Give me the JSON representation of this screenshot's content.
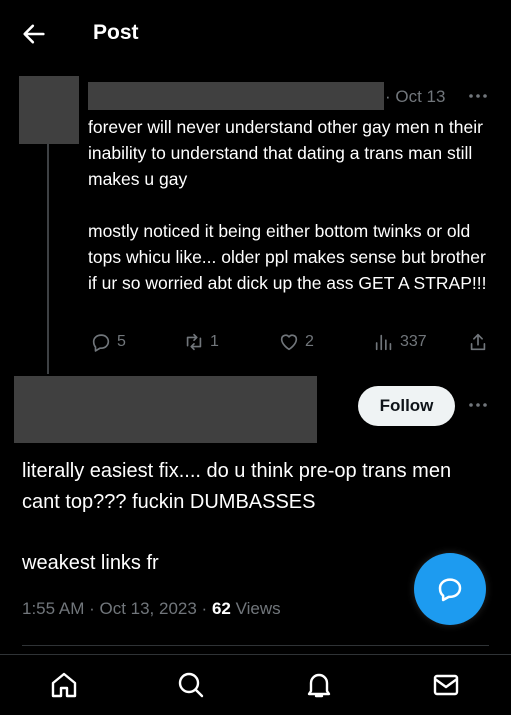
{
  "header": {
    "title": "Post",
    "back_icon": "arrow-left-icon"
  },
  "reply": {
    "date": "· Oct 13",
    "text": "forever will never understand other gay men n their inability to understand that dating a trans man still makes u gay\n\nmostly noticed it being either bottom twinks or old tops whicu like... older ppl makes sense but brother if ur so worried abt dick up the ass GET A STRAP!!!",
    "actions": {
      "replies": "5",
      "reposts": "1",
      "likes": "2",
      "views": "337"
    }
  },
  "main": {
    "follow_label": "Follow",
    "text_1": "literally easiest fix.... do u think pre-op trans men cant top??? fuckin DUMBASSES",
    "text_2": "weakest links fr",
    "time": "1:55 AM · Oct 13, 2023 · ",
    "views_count": "62",
    "views_label": " Views"
  },
  "colors": {
    "accent": "#1d9bf0",
    "muted": "#71767b",
    "background": "#000000",
    "redaction": "#404040"
  },
  "nav": [
    "home-icon",
    "search-icon",
    "bell-icon",
    "mail-icon"
  ]
}
